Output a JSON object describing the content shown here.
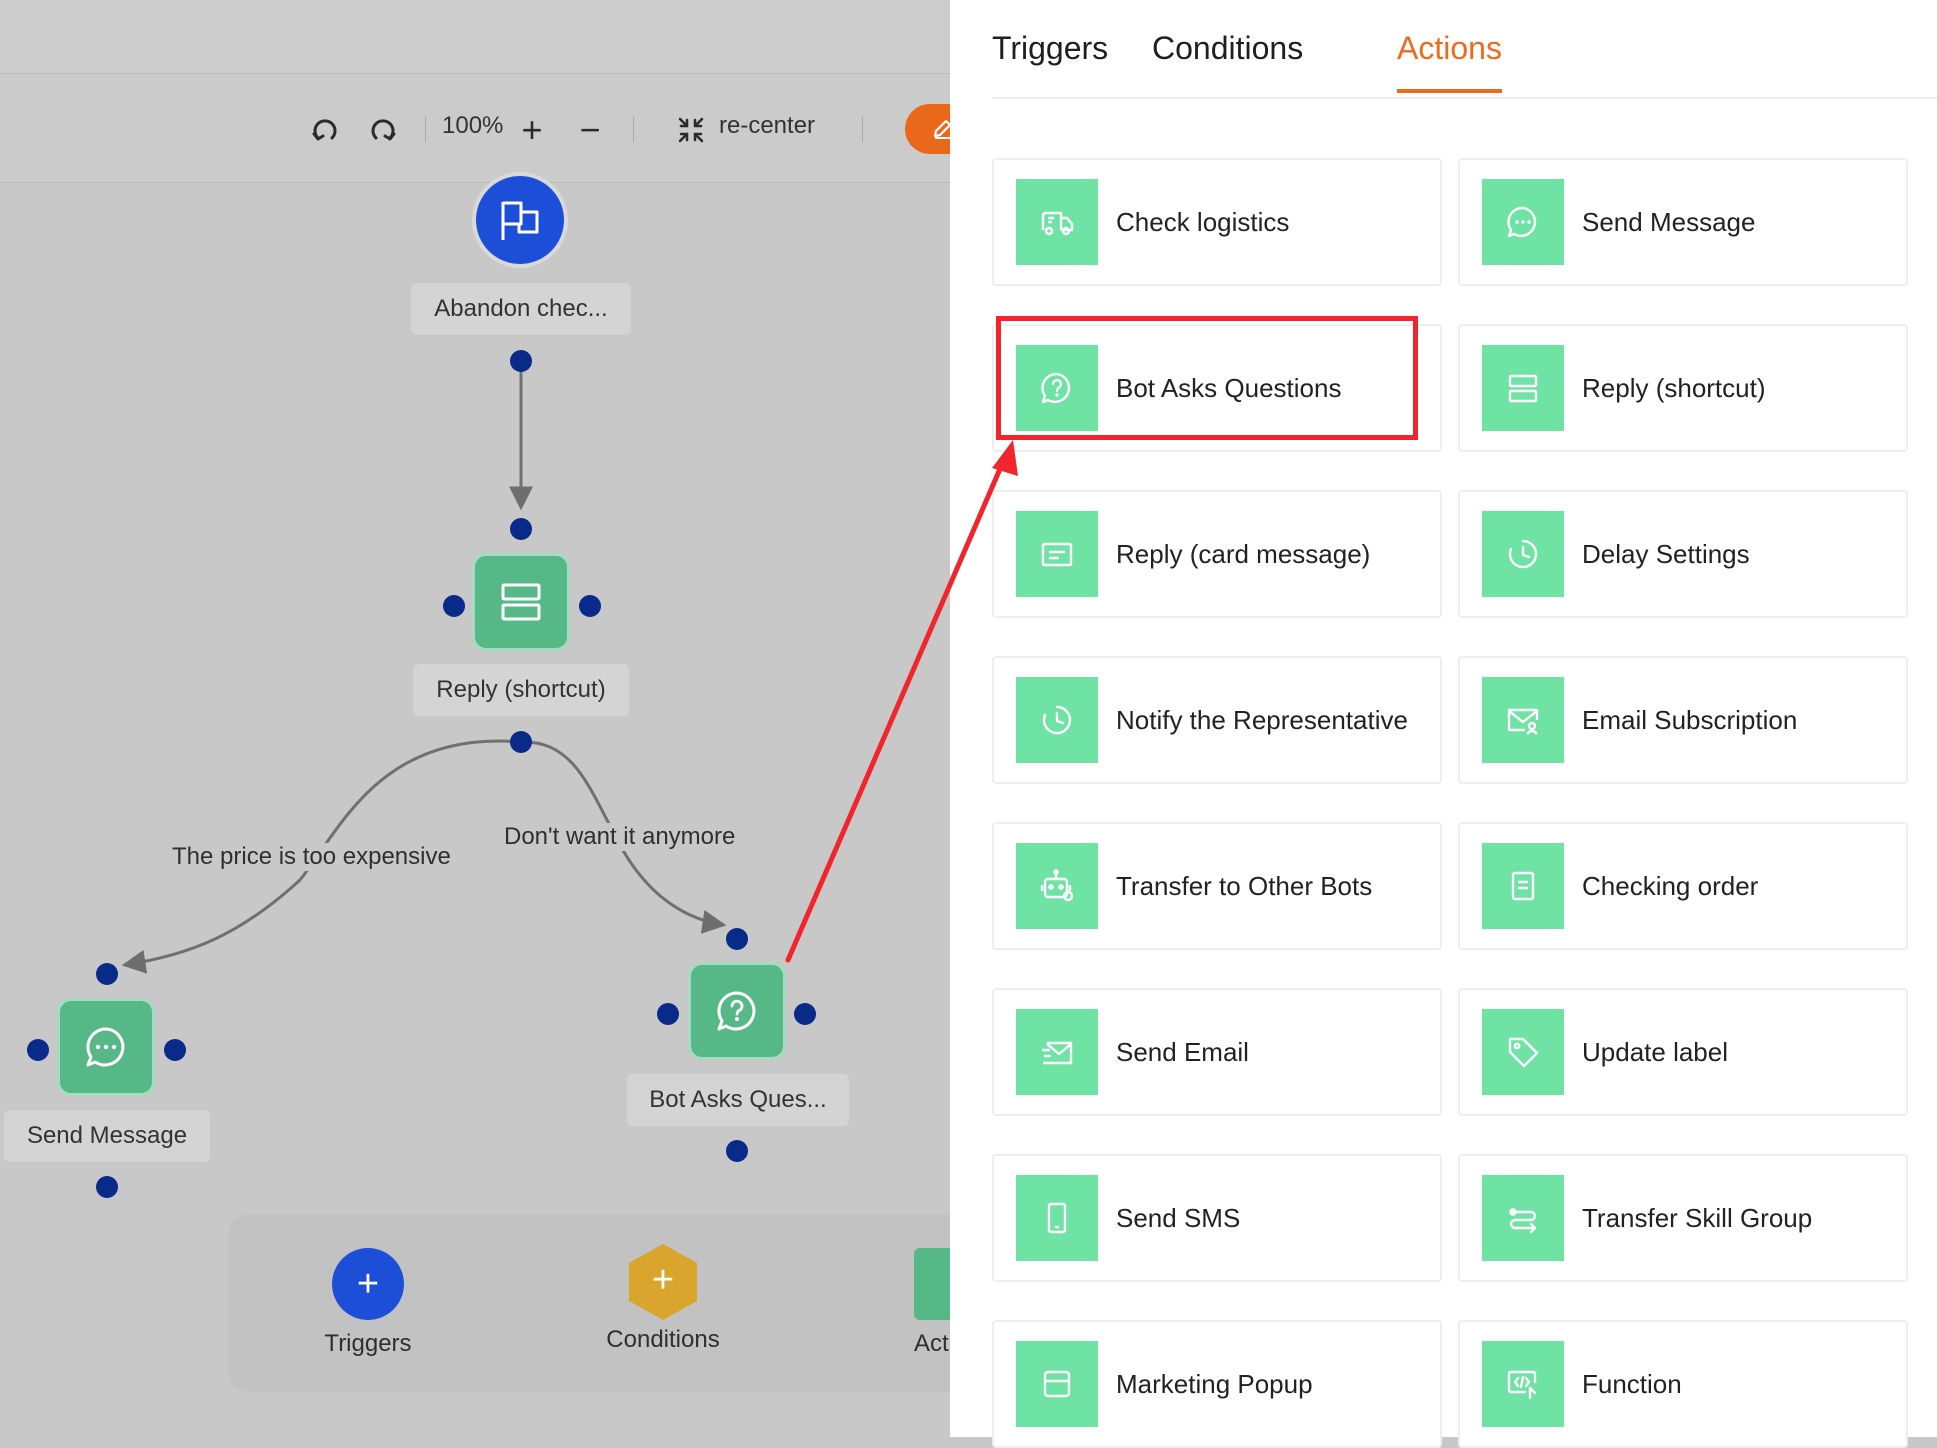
{
  "toolbar": {
    "undo_icon": "undo-icon",
    "redo_icon": "redo-icon",
    "zoom_level": "100%",
    "zoom_in_label": "+",
    "zoom_out_label": "−",
    "recenter_label": "re-center"
  },
  "flow": {
    "start_node": {
      "label": "Abandon chec...",
      "icon": "flag-icon"
    },
    "reply_node": {
      "label": "Reply (shortcut)",
      "icon": "layout-rows-icon"
    },
    "send_node": {
      "label": "Send Message",
      "icon": "chat-bubble-icon"
    },
    "bot_node": {
      "label": "Bot Asks Ques...",
      "icon": "question-icon"
    },
    "edge_left_label": "The price is too expensive",
    "edge_right_label": "Don't want it anymore"
  },
  "palette": {
    "triggers_label": "Triggers",
    "conditions_label": "Conditions",
    "actions_label": "Act",
    "plus_symbol": "+"
  },
  "tabs": [
    {
      "label": "Triggers",
      "active": false
    },
    {
      "label": "Conditions",
      "active": false
    },
    {
      "label": "Actions",
      "active": true
    }
  ],
  "actions": [
    {
      "label": "Check logistics",
      "icon": "truck-icon"
    },
    {
      "label": "Send Message",
      "icon": "chat-bubble-icon"
    },
    {
      "label": "Bot Asks Questions",
      "icon": "question-icon"
    },
    {
      "label": "Reply (shortcut)",
      "icon": "layout-rows-icon"
    },
    {
      "label": "Reply (card message)",
      "icon": "card-icon"
    },
    {
      "label": "Delay Settings",
      "icon": "clock-icon"
    },
    {
      "label": "Notify the Representative",
      "icon": "clock-icon"
    },
    {
      "label": "Email Subscription",
      "icon": "mail-user-icon"
    },
    {
      "label": "Transfer to Other Bots",
      "icon": "robot-icon"
    },
    {
      "label": "Checking order",
      "icon": "document-icon"
    },
    {
      "label": "Send Email",
      "icon": "send-mail-icon"
    },
    {
      "label": "Update label",
      "icon": "tag-icon"
    },
    {
      "label": "Send SMS",
      "icon": "phone-icon"
    },
    {
      "label": "Transfer Skill Group",
      "icon": "transfer-icon"
    },
    {
      "label": "Marketing Popup",
      "icon": "popup-icon"
    },
    {
      "label": "Function",
      "icon": "code-icon"
    }
  ],
  "colors": {
    "accent": "#ee6a1d",
    "action_icon_bg": "#6ee3a4",
    "node_green": "#56b886",
    "trigger_blue": "#1c4ed8",
    "condition_gold": "#d9a52c",
    "highlight_red": "#f0262c"
  }
}
